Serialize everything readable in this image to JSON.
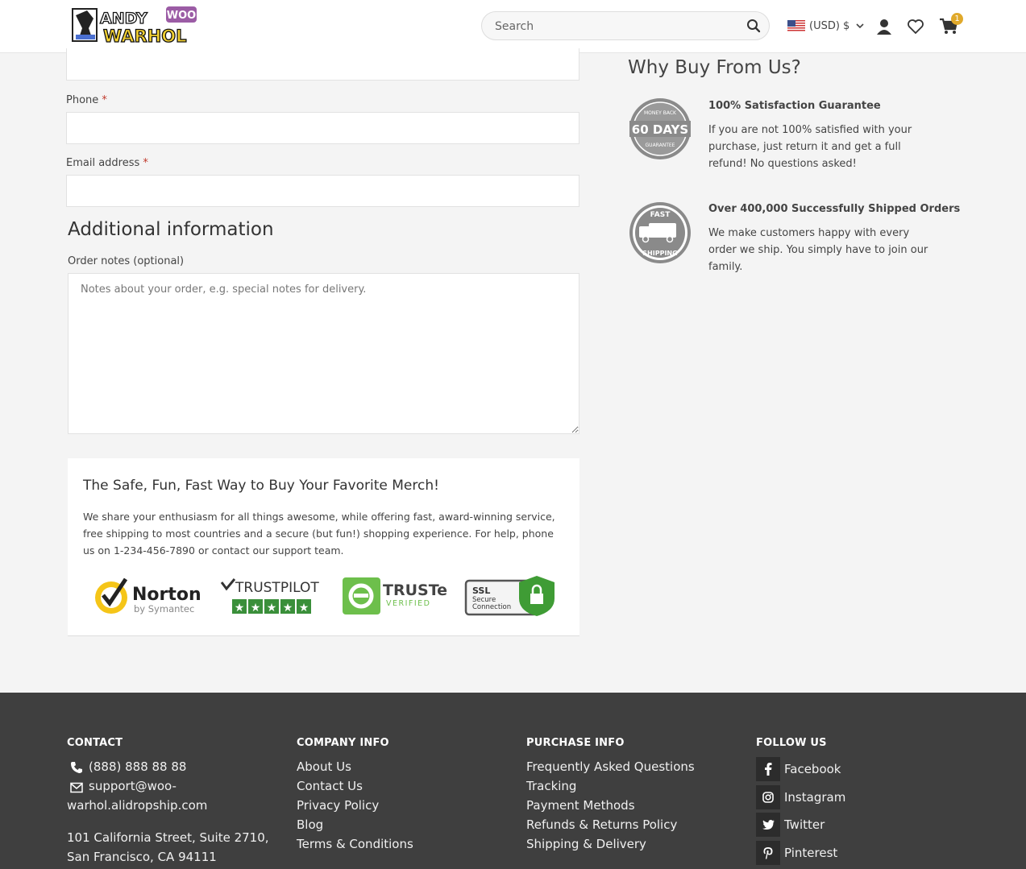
{
  "header": {
    "logo_text_1": "ANDY",
    "logo_badge": "WOO",
    "logo_text_2": "WARHOL",
    "search_placeholder": "Search",
    "currency": "(USD) $",
    "cart_count": "1"
  },
  "form": {
    "phone_label": "Phone",
    "email_label": "Email address",
    "required_mark": "*",
    "additional_title": "Additional information",
    "notes_label": "Order notes (optional)",
    "notes_placeholder": "Notes about your order, e.g. special notes for delivery."
  },
  "trust": {
    "title": "The Safe, Fun, Fast Way to Buy Your Favorite Merch!",
    "text": "We share your enthusiasm for all things awesome, while offering fast, award-winning service, free shipping to most countries and a secure (but fun!) shopping experience. For help, phone us on 1-234-456-7890 or contact our support team.",
    "norton_name": "Norton",
    "norton_sub": "by Symantec",
    "trustpilot": "TRUSTPILOT",
    "truste": "TRUSTe",
    "truste_sub": "VERIFIED",
    "ssl_line1": "SSL",
    "ssl_line2": "Secure",
    "ssl_line3": "Connection"
  },
  "why": {
    "title": "Why Buy From Us?",
    "items": [
      {
        "badge_top": "MONEY BACK",
        "badge_main": "60 DAYS",
        "badge_bottom": "GUARANTEE",
        "title": "100% Satisfaction Guarantee",
        "text": "If you are not 100% satisfied with your purchase, just return it and get a full refund! No questions asked!"
      },
      {
        "badge_top": "FAST",
        "badge_bottom": "SHIPPING",
        "title": "Over 400,000 Successfully Shipped Orders",
        "text": "We make customers happy with every order we ship. You simply have to join our family."
      }
    ]
  },
  "footer": {
    "contact": {
      "heading": "CONTACT",
      "phone": "(888) 888 88 88",
      "email_1": "support@woo-",
      "email_2": "warhol.alidropship.com",
      "address_1": "101 California Street, Suite 2710,",
      "address_2": "San Francisco, CA 94111"
    },
    "company": {
      "heading": "COMPANY INFO",
      "links": [
        "About Us",
        "Contact Us",
        "Privacy Policy",
        "Blog",
        "Terms & Conditions"
      ]
    },
    "purchase": {
      "heading": "PURCHASE INFO",
      "links": [
        "Frequently Asked Questions",
        "Tracking",
        "Payment Methods",
        "Refunds & Returns Policy",
        "Shipping & Delivery"
      ]
    },
    "follow": {
      "heading": "FOLLOW US",
      "links": [
        "Facebook",
        "Instagram",
        "Twitter",
        "Pinterest"
      ]
    }
  }
}
